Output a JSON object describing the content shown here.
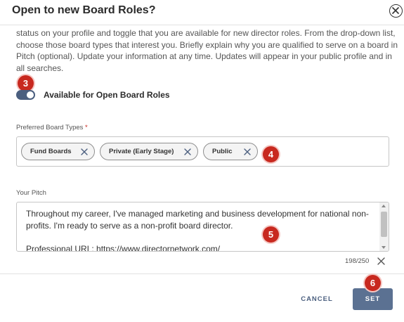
{
  "dialog": {
    "title": "Open to new Board Roles?",
    "intro": "status on your profile and toggle that you are available for new director roles. From the drop-down list, choose those board types that interest you. Briefly explain why you are qualified to serve on a board in Pitch (optional). Update your information at any time. Updates will appear in your public profile and in all searches."
  },
  "availability": {
    "label": "Available for Open Board Roles",
    "enabled": true
  },
  "board_types": {
    "label": "Preferred Board Types",
    "required_mark": "*",
    "chips": [
      {
        "label": "Fund Boards"
      },
      {
        "label": "Private (Early Stage)"
      },
      {
        "label": "Public"
      }
    ]
  },
  "pitch": {
    "label": "Your Pitch",
    "value": "Throughout my career, I've managed marketing and business development for national non-profits. I'm ready to serve as a non-profit board director.\n\nProfessional URL: https://www.directornetwork.com/",
    "counter": "198/250"
  },
  "markers": {
    "m3": "3",
    "m4": "4",
    "m5": "5",
    "m6": "6"
  },
  "footer": {
    "cancel_label": "CANCEL",
    "set_label": "SET"
  },
  "icons": {
    "close": "close-circle-icon",
    "chip_remove": "x-icon",
    "clear": "x-icon"
  },
  "colors": {
    "accent": "#4b5f7f",
    "primary_button": "#5b7192",
    "marker": "#c8291f"
  }
}
